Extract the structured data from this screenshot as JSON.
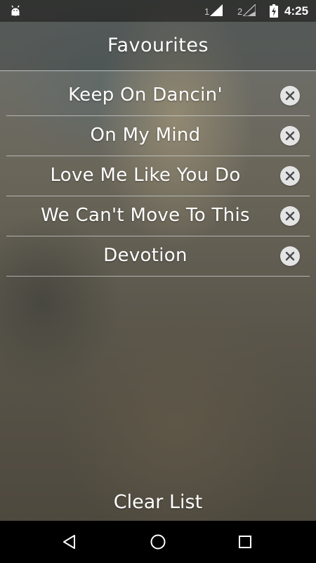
{
  "status_bar": {
    "sim1_label": "1",
    "sim2_label": "2",
    "time": "4:25",
    "icons": [
      "android-notification-icon",
      "signal-sim1-icon",
      "signal-sim2-icon",
      "battery-charging-icon"
    ]
  },
  "header": {
    "title": "Favourites"
  },
  "favourites": [
    {
      "title": "Keep On Dancin'",
      "remove_icon": "close-circle-icon"
    },
    {
      "title": "On My Mind",
      "remove_icon": "close-circle-icon"
    },
    {
      "title": "Love Me Like You Do",
      "remove_icon": "close-circle-icon"
    },
    {
      "title": "We Can't Move To This",
      "remove_icon": "close-circle-icon"
    },
    {
      "title": "Devotion",
      "remove_icon": "close-circle-icon"
    }
  ],
  "footer": {
    "clear_label": "Clear List"
  },
  "nav_bar": {
    "icons": [
      "back-icon",
      "home-icon",
      "recents-icon"
    ]
  },
  "colors": {
    "text": "#ffffff",
    "remove_button_bg": "#e4e4e4",
    "remove_button_x": "#4a4a4a",
    "nav_bar_bg": "#000000"
  }
}
